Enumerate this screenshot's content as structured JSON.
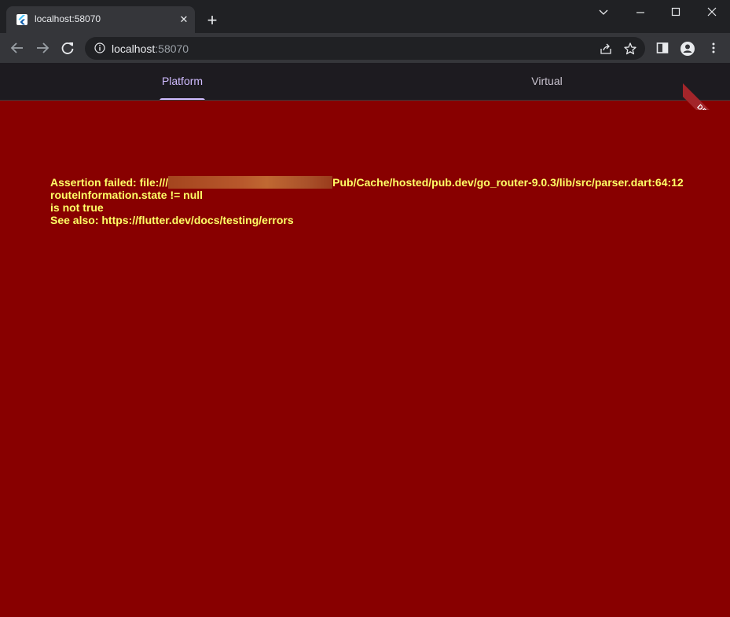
{
  "browser": {
    "tab_title": "localhost:58070",
    "url_host": "localhost",
    "url_port": ":58070"
  },
  "app": {
    "tabs": [
      {
        "label": "Platform",
        "selected": true
      },
      {
        "label": "Virtual",
        "selected": false
      }
    ],
    "debug_banner": "DEBUG"
  },
  "error": {
    "line1_prefix": "Assertion failed: file:///",
    "line1_suffix": "Pub/Cache/hosted/pub.dev/go_router-9.0.3/lib/src/parser.dart:64:12",
    "line2": "routeInformation.state != null",
    "line3": "is not true",
    "line4": "See also: https://flutter.dev/docs/testing/errors"
  },
  "colors": {
    "error_background": "#880000",
    "error_text": "#ffff66",
    "tab_selected": "#d0bcff"
  }
}
